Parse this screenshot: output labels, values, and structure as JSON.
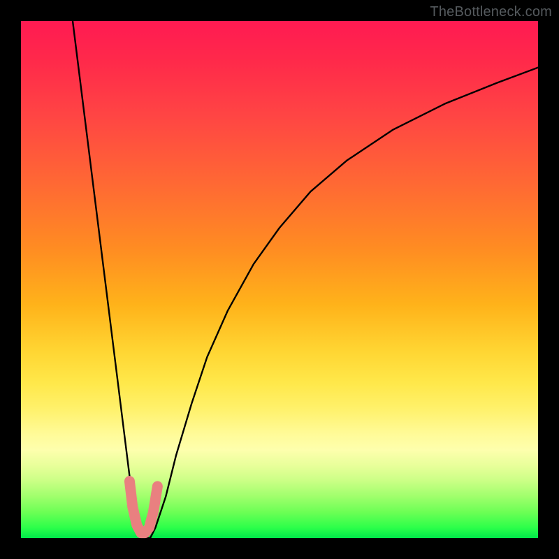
{
  "watermark": "TheBottleneck.com",
  "chart_data": {
    "type": "line",
    "title": "",
    "xlabel": "",
    "ylabel": "",
    "xlim": [
      0,
      100
    ],
    "ylim": [
      0,
      100
    ],
    "series": [
      {
        "name": "bottleneck-curve",
        "x": [
          10,
          12,
          14,
          16,
          18,
          20,
          21,
          22,
          23,
          24,
          25,
          26,
          28,
          30,
          33,
          36,
          40,
          45,
          50,
          56,
          63,
          72,
          82,
          92,
          100
        ],
        "values": [
          100,
          84,
          68,
          52,
          36,
          20,
          12,
          6,
          2,
          0,
          0,
          2,
          8,
          16,
          26,
          35,
          44,
          53,
          60,
          67,
          73,
          79,
          84,
          88,
          91
        ]
      }
    ],
    "annotations": [
      {
        "name": "optimal-marker",
        "x": [
          21.0,
          21.6,
          22.4,
          23.2,
          24.0,
          24.8,
          25.6,
          26.4
        ],
        "values": [
          11.0,
          6.0,
          2.5,
          1.0,
          1.0,
          2.0,
          5.0,
          10.0
        ]
      }
    ]
  }
}
